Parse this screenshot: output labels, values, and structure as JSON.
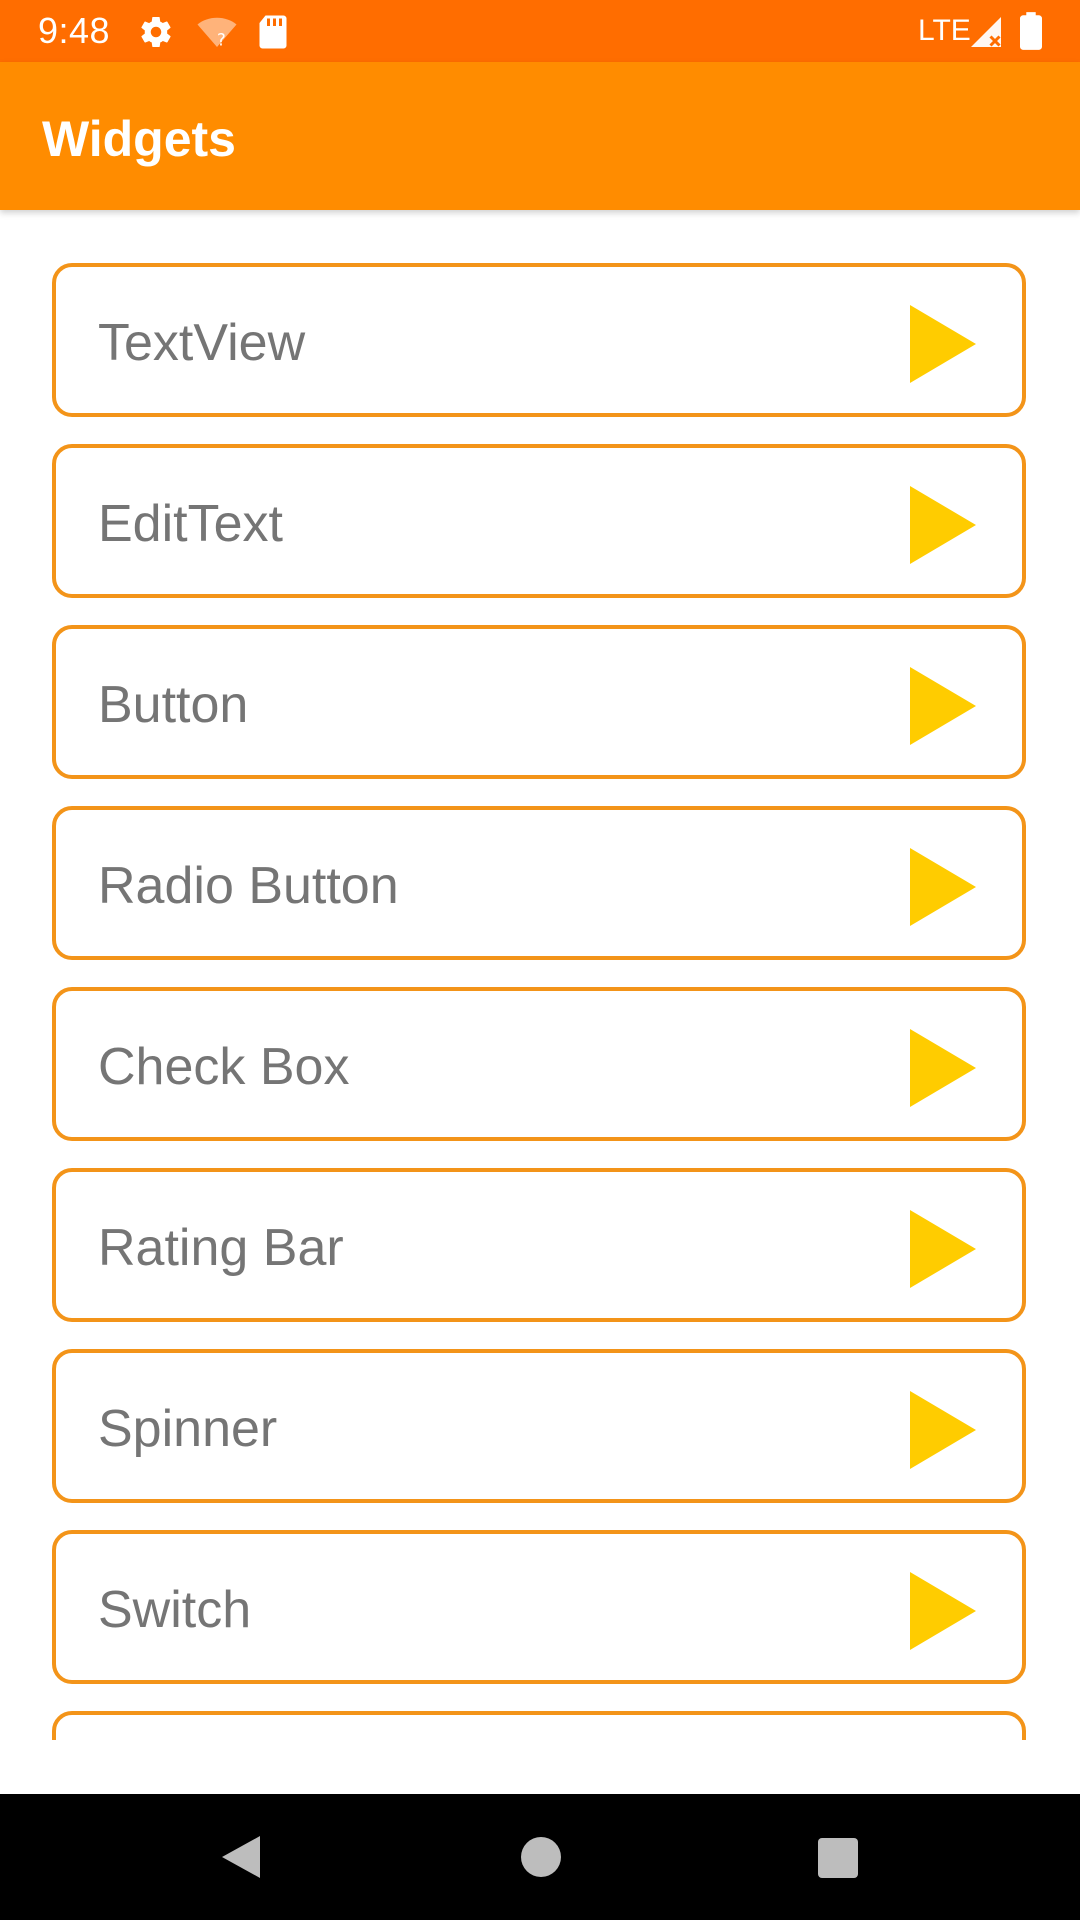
{
  "status_bar": {
    "time": "9:48",
    "network": "LTE",
    "icons": [
      "gear-icon",
      "wifi-question-icon",
      "sd-card-icon",
      "signal-icon",
      "battery-icon"
    ],
    "background": "#FF6D00"
  },
  "app_bar": {
    "title": "Widgets",
    "background": "#FF8C00"
  },
  "list": {
    "items": [
      {
        "label": "TextView",
        "icon": "play-arrow-icon"
      },
      {
        "label": "EditText",
        "icon": "play-arrow-icon"
      },
      {
        "label": "Button",
        "icon": "play-arrow-icon"
      },
      {
        "label": "Radio Button",
        "icon": "play-arrow-icon"
      },
      {
        "label": "Check Box",
        "icon": "play-arrow-icon"
      },
      {
        "label": "Rating Bar",
        "icon": "play-arrow-icon"
      },
      {
        "label": "Spinner",
        "icon": "play-arrow-icon"
      },
      {
        "label": "Switch",
        "icon": "play-arrow-icon"
      },
      {
        "label": "",
        "icon": "play-arrow-icon"
      }
    ],
    "border_color": "#F39419",
    "icon_color": "#FFCC00",
    "label_color": "#757575"
  },
  "nav_bar": {
    "icons": [
      "back-icon",
      "home-icon",
      "recents-icon"
    ]
  }
}
